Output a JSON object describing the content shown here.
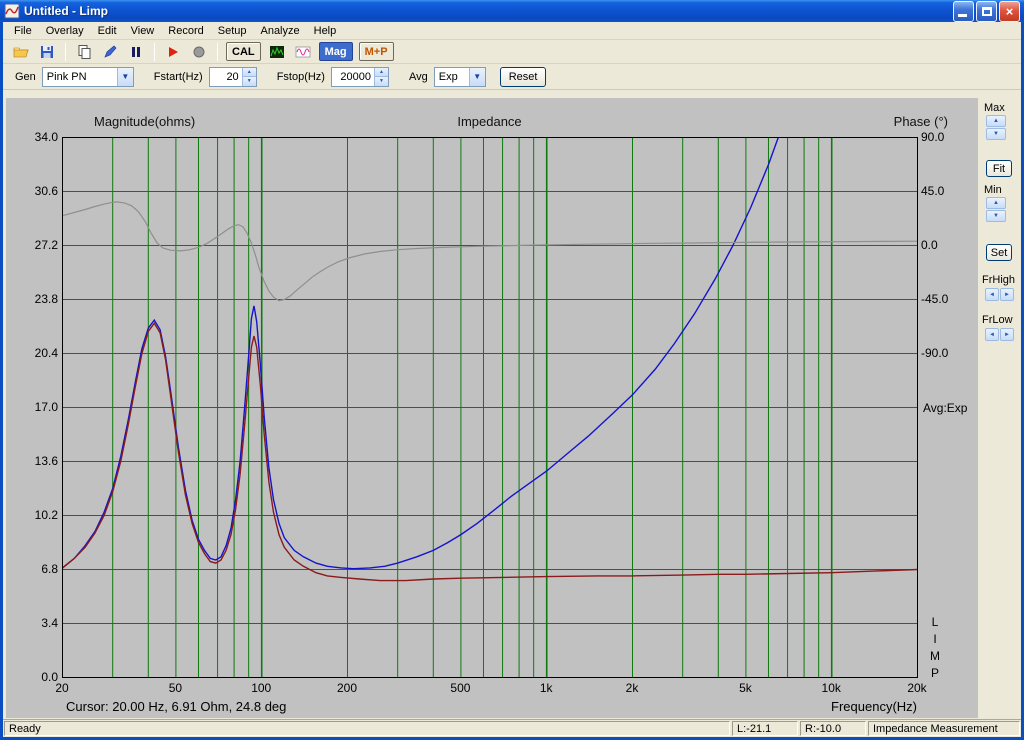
{
  "window": {
    "title": "Untitled - Limp"
  },
  "menu": {
    "items": [
      "File",
      "Overlay",
      "Edit",
      "View",
      "Record",
      "Setup",
      "Analyze",
      "Help"
    ]
  },
  "toolbar": {
    "cal_label": "CAL",
    "mag_label": "Mag",
    "mp_label": "M+P"
  },
  "controls": {
    "gen_label": "Gen",
    "gen_value": "Pink PN",
    "fstart_label": "Fstart(Hz)",
    "fstart_value": "20",
    "fstop_label": "Fstop(Hz)",
    "fstop_value": "20000",
    "avg_label": "Avg",
    "avg_value": "Exp",
    "reset_label": "Reset"
  },
  "right_panel": {
    "max_label": "Max",
    "fit_label": "Fit",
    "min_label": "Min",
    "set_label": "Set",
    "frhigh_label": "FrHigh",
    "frlow_label": "FrLow"
  },
  "chart": {
    "left_axis_title": "Magnitude(ohms)",
    "title": "Impedance",
    "right_axis_title": "Phase (°)",
    "x_axis_title": "Frequency(Hz)",
    "cursor_text": "Cursor: 20.00 Hz, 6.91 Ohm, 24.8 deg",
    "avg_text": "Avg:Exp",
    "limp_text": "LIMP"
  },
  "statusbar": {
    "ready": "Ready",
    "left_level": "L:-21.1",
    "right_level": "R:-10.0",
    "mode": "Impedance Measurement"
  },
  "chart_data": {
    "type": "line",
    "title": "Impedance",
    "plot_bg": "#C1C1C1",
    "grid_color": "#0F7A0F",
    "x_axis": {
      "label": "Frequency(Hz)",
      "scale": "log",
      "min": 20,
      "max": 20000,
      "ticks": [
        {
          "label": "20",
          "f": 20
        },
        {
          "label": "50",
          "f": 50
        },
        {
          "label": "100",
          "f": 100
        },
        {
          "label": "200",
          "f": 200
        },
        {
          "label": "500",
          "f": 500
        },
        {
          "label": "1k",
          "f": 1000
        },
        {
          "label": "2k",
          "f": 2000
        },
        {
          "label": "5k",
          "f": 5000
        },
        {
          "label": "10k",
          "f": 10000
        },
        {
          "label": "20k",
          "f": 20000
        }
      ],
      "grid_freqs": [
        20,
        30,
        40,
        50,
        60,
        70,
        80,
        90,
        100,
        200,
        300,
        400,
        500,
        600,
        700,
        800,
        900,
        1000,
        2000,
        3000,
        4000,
        5000,
        6000,
        7000,
        8000,
        9000,
        10000,
        20000
      ]
    },
    "left_axis": {
      "label": "Magnitude(ohms)",
      "min": 0,
      "max": 34,
      "ticks": [
        "34.0",
        "30.6",
        "27.2",
        "23.8",
        "20.4",
        "17.0",
        "13.6",
        "10.2",
        "6.8",
        "3.4",
        "0.0"
      ]
    },
    "right_axis": {
      "label": "Phase (°)",
      "deg_per_div": 45,
      "zero_div_from_top": 2,
      "ticks": [
        "90.0",
        "45.0",
        "0.0",
        "-45.0",
        "-90.0"
      ]
    },
    "cursor": {
      "freq_hz": 20.0,
      "ohm": 6.91,
      "deg": 24.8
    },
    "averaging": "Exp",
    "series": [
      {
        "name": "impedance-magnitude",
        "axis": "mag",
        "color": "#1414CC",
        "points": [
          [
            20,
            6.9
          ],
          [
            22,
            7.5
          ],
          [
            24,
            8.3
          ],
          [
            26,
            9.2
          ],
          [
            28,
            10.4
          ],
          [
            30,
            11.9
          ],
          [
            32,
            13.9
          ],
          [
            34,
            16.2
          ],
          [
            36,
            18.6
          ],
          [
            38,
            20.7
          ],
          [
            40,
            22.0
          ],
          [
            42,
            22.5
          ],
          [
            44,
            21.9
          ],
          [
            46,
            20.2
          ],
          [
            48,
            17.9
          ],
          [
            51,
            14.5
          ],
          [
            54,
            11.8
          ],
          [
            57,
            9.9
          ],
          [
            60,
            8.7
          ],
          [
            63,
            8.0
          ],
          [
            66,
            7.5
          ],
          [
            69,
            7.4
          ],
          [
            72,
            7.6
          ],
          [
            75,
            8.3
          ],
          [
            78,
            9.4
          ],
          [
            81,
            11.2
          ],
          [
            84,
            13.6
          ],
          [
            87,
            16.9
          ],
          [
            90,
            20.3
          ],
          [
            92,
            22.6
          ],
          [
            94,
            23.4
          ],
          [
            96,
            22.4
          ],
          [
            99,
            19.6
          ],
          [
            102,
            16.4
          ],
          [
            106,
            13.2
          ],
          [
            110,
            11.2
          ],
          [
            115,
            9.7
          ],
          [
            120,
            8.8
          ],
          [
            130,
            8.0
          ],
          [
            140,
            7.6
          ],
          [
            155,
            7.2
          ],
          [
            170,
            7.0
          ],
          [
            190,
            6.9
          ],
          [
            210,
            6.85
          ],
          [
            240,
            6.9
          ],
          [
            270,
            7.0
          ],
          [
            300,
            7.2
          ],
          [
            350,
            7.6
          ],
          [
            400,
            8.0
          ],
          [
            450,
            8.5
          ],
          [
            500,
            9.0
          ],
          [
            570,
            9.7
          ],
          [
            650,
            10.5
          ],
          [
            750,
            11.4
          ],
          [
            850,
            12.1
          ],
          [
            1000,
            13.0
          ],
          [
            1200,
            14.2
          ],
          [
            1400,
            15.2
          ],
          [
            1700,
            16.6
          ],
          [
            2000,
            17.8
          ],
          [
            2400,
            19.4
          ],
          [
            2800,
            21.0
          ],
          [
            3300,
            22.9
          ],
          [
            3900,
            25.1
          ],
          [
            4500,
            27.2
          ],
          [
            5200,
            29.6
          ],
          [
            6000,
            32.3
          ],
          [
            6800,
            35.0
          ]
        ]
      },
      {
        "name": "impedance-magnitude-overlay",
        "axis": "mag",
        "color": "#8B1A1A",
        "points": [
          [
            20,
            6.9
          ],
          [
            22,
            7.5
          ],
          [
            24,
            8.2
          ],
          [
            26,
            9.1
          ],
          [
            28,
            10.2
          ],
          [
            30,
            11.7
          ],
          [
            32,
            13.6
          ],
          [
            34,
            15.9
          ],
          [
            36,
            18.3
          ],
          [
            38,
            20.4
          ],
          [
            40,
            21.8
          ],
          [
            42,
            22.3
          ],
          [
            44,
            21.7
          ],
          [
            46,
            20.0
          ],
          [
            48,
            17.6
          ],
          [
            51,
            14.2
          ],
          [
            54,
            11.5
          ],
          [
            57,
            9.7
          ],
          [
            60,
            8.5
          ],
          [
            63,
            7.8
          ],
          [
            66,
            7.3
          ],
          [
            69,
            7.2
          ],
          [
            72,
            7.4
          ],
          [
            75,
            8.0
          ],
          [
            78,
            9.0
          ],
          [
            81,
            10.6
          ],
          [
            84,
            12.8
          ],
          [
            87,
            15.8
          ],
          [
            90,
            18.9
          ],
          [
            92,
            20.8
          ],
          [
            94,
            21.5
          ],
          [
            96,
            20.8
          ],
          [
            99,
            18.3
          ],
          [
            102,
            15.3
          ],
          [
            106,
            12.3
          ],
          [
            110,
            10.4
          ],
          [
            115,
            9.0
          ],
          [
            120,
            8.2
          ],
          [
            130,
            7.4
          ],
          [
            140,
            7.0
          ],
          [
            155,
            6.6
          ],
          [
            170,
            6.4
          ],
          [
            190,
            6.3
          ],
          [
            220,
            6.2
          ],
          [
            260,
            6.1
          ],
          [
            320,
            6.1
          ],
          [
            400,
            6.2
          ],
          [
            500,
            6.25
          ],
          [
            700,
            6.3
          ],
          [
            1000,
            6.35
          ],
          [
            1500,
            6.4
          ],
          [
            2000,
            6.4
          ],
          [
            3000,
            6.45
          ],
          [
            4000,
            6.5
          ],
          [
            5000,
            6.5
          ],
          [
            7000,
            6.55
          ],
          [
            10000,
            6.6
          ],
          [
            14000,
            6.7
          ],
          [
            20000,
            6.8
          ]
        ]
      },
      {
        "name": "impedance-phase",
        "axis": "phase",
        "color": "#8F8F8F",
        "points": [
          [
            20,
            24.8
          ],
          [
            22,
            27.5
          ],
          [
            24,
            30
          ],
          [
            26,
            32.5
          ],
          [
            28,
            34.5
          ],
          [
            30,
            36
          ],
          [
            31,
            36.3
          ],
          [
            33,
            35.5
          ],
          [
            35,
            33
          ],
          [
            37,
            28
          ],
          [
            39,
            20
          ],
          [
            41,
            10
          ],
          [
            43,
            2
          ],
          [
            45,
            -2
          ],
          [
            48,
            -4
          ],
          [
            52,
            -4.5
          ],
          [
            56,
            -3.5
          ],
          [
            60,
            -1.5
          ],
          [
            64,
            1.5
          ],
          [
            68,
            5.5
          ],
          [
            72,
            9.5
          ],
          [
            76,
            13.5
          ],
          [
            80,
            16.5
          ],
          [
            83,
            17.3
          ],
          [
            86,
            15.5
          ],
          [
            89,
            10
          ],
          [
            92,
            2
          ],
          [
            95,
            -8
          ],
          [
            98,
            -19
          ],
          [
            102,
            -30
          ],
          [
            106,
            -38
          ],
          [
            110,
            -43
          ],
          [
            115,
            -46
          ],
          [
            120,
            -45
          ],
          [
            126,
            -42
          ],
          [
            133,
            -37
          ],
          [
            141,
            -32
          ],
          [
            150,
            -26.5
          ],
          [
            160,
            -22
          ],
          [
            172,
            -17.5
          ],
          [
            186,
            -13.5
          ],
          [
            205,
            -10
          ],
          [
            230,
            -7
          ],
          [
            260,
            -5
          ],
          [
            300,
            -3.5
          ],
          [
            350,
            -2.5
          ],
          [
            420,
            -1.7
          ],
          [
            500,
            -1.1
          ],
          [
            600,
            -0.6
          ],
          [
            750,
            -0.1
          ],
          [
            900,
            0.3
          ],
          [
            1100,
            0.7
          ],
          [
            1400,
            1.1
          ],
          [
            1800,
            1.4
          ],
          [
            2400,
            1.8
          ],
          [
            3200,
            2.1
          ],
          [
            4500,
            2.5
          ],
          [
            6000,
            2.8
          ],
          [
            8000,
            3.0
          ],
          [
            11000,
            3.2
          ],
          [
            15000,
            3.4
          ],
          [
            20000,
            3.6
          ]
        ]
      }
    ]
  }
}
